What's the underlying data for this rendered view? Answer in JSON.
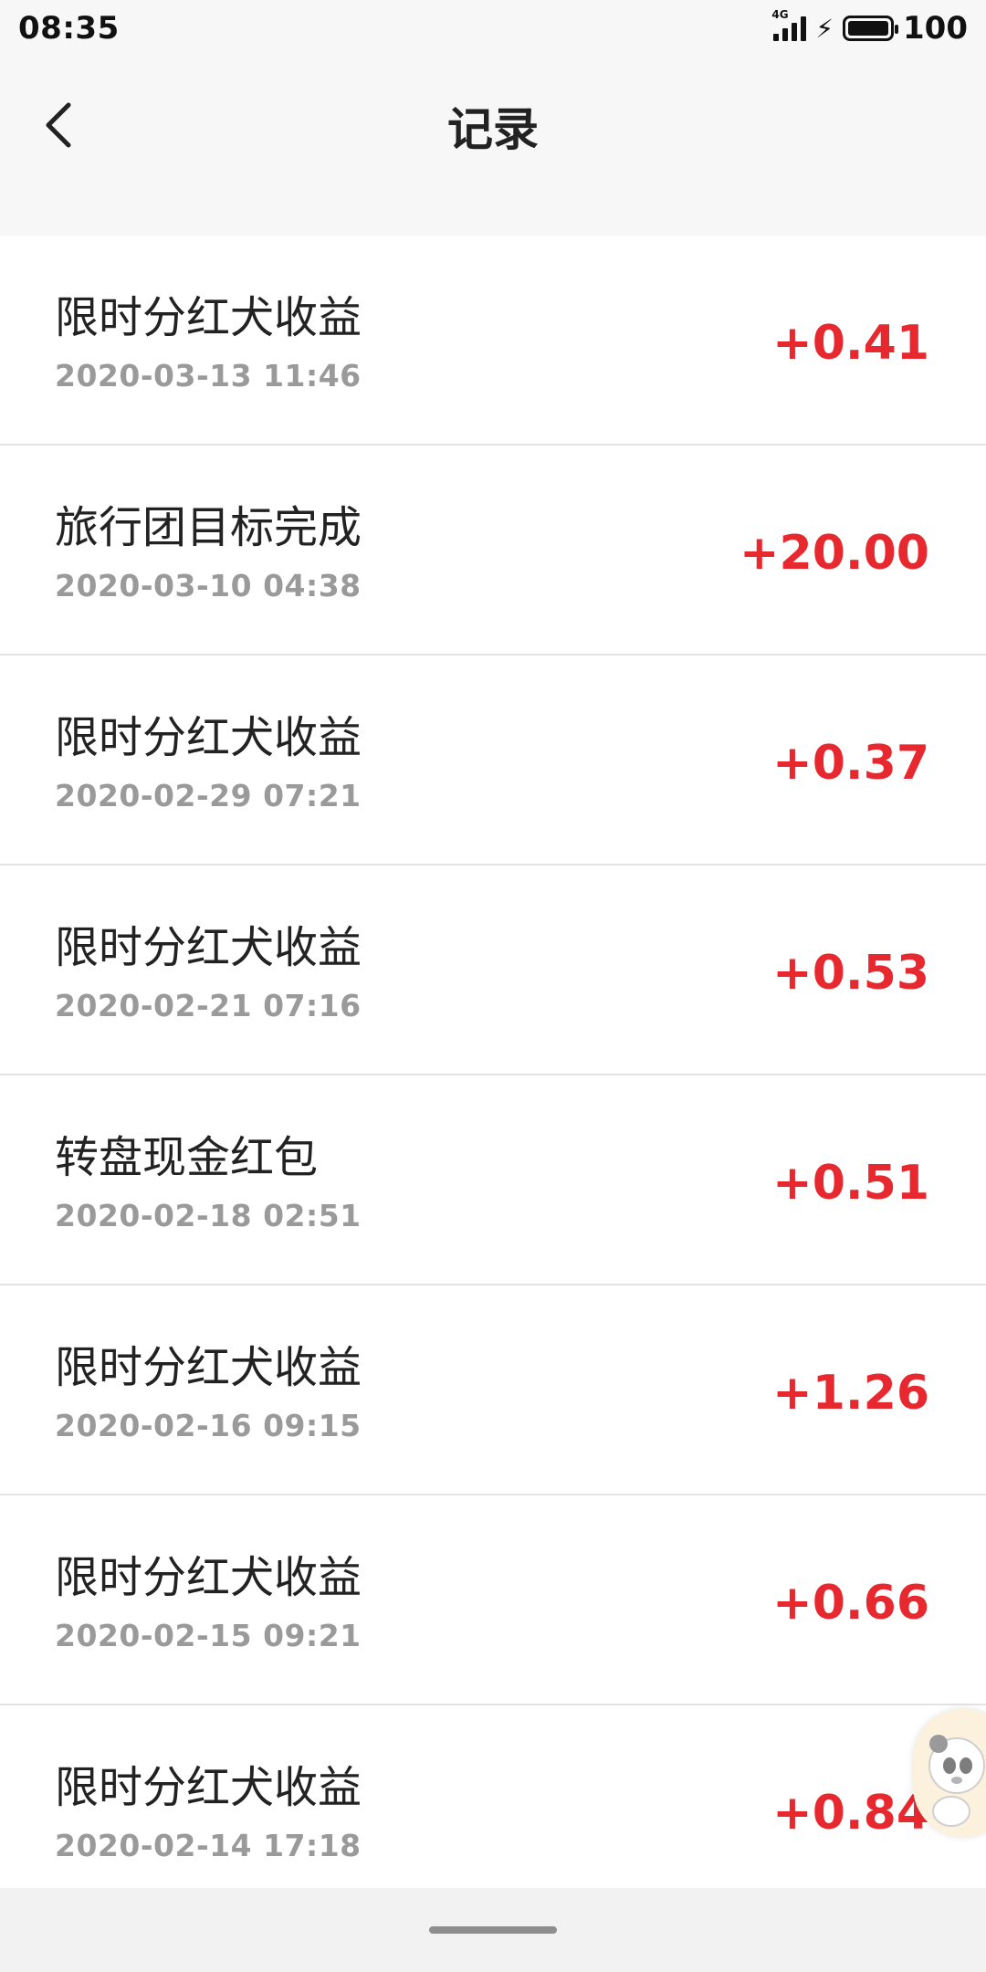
{
  "status_bar": {
    "time": "08:35",
    "network": "4G",
    "battery": "100"
  },
  "header": {
    "title": "记录"
  },
  "records": [
    {
      "title": "限时分红犬收益",
      "time": "2020-03-13 11:46",
      "amount": "+0.41"
    },
    {
      "title": "旅行团目标完成",
      "time": "2020-03-10 04:38",
      "amount": "+20.00"
    },
    {
      "title": "限时分红犬收益",
      "time": "2020-02-29 07:21",
      "amount": "+0.37"
    },
    {
      "title": "限时分红犬收益",
      "time": "2020-02-21 07:16",
      "amount": "+0.53"
    },
    {
      "title": "转盘现金红包",
      "time": "2020-02-18 02:51",
      "amount": "+0.51"
    },
    {
      "title": "限时分红犬收益",
      "time": "2020-02-16 09:15",
      "amount": "+1.26"
    },
    {
      "title": "限时分红犬收益",
      "time": "2020-02-15 09:21",
      "amount": "+0.66"
    },
    {
      "title": "限时分红犬收益",
      "time": "2020-02-14 17:18",
      "amount": "+0.84"
    }
  ],
  "icons": {
    "back": "chevron-left-icon",
    "signal": "signal-icon",
    "charging": "bolt-icon",
    "battery": "battery-icon",
    "widget": "panda-icon"
  },
  "colors": {
    "amount": "#e8282f",
    "background": "#f7f7f7"
  }
}
